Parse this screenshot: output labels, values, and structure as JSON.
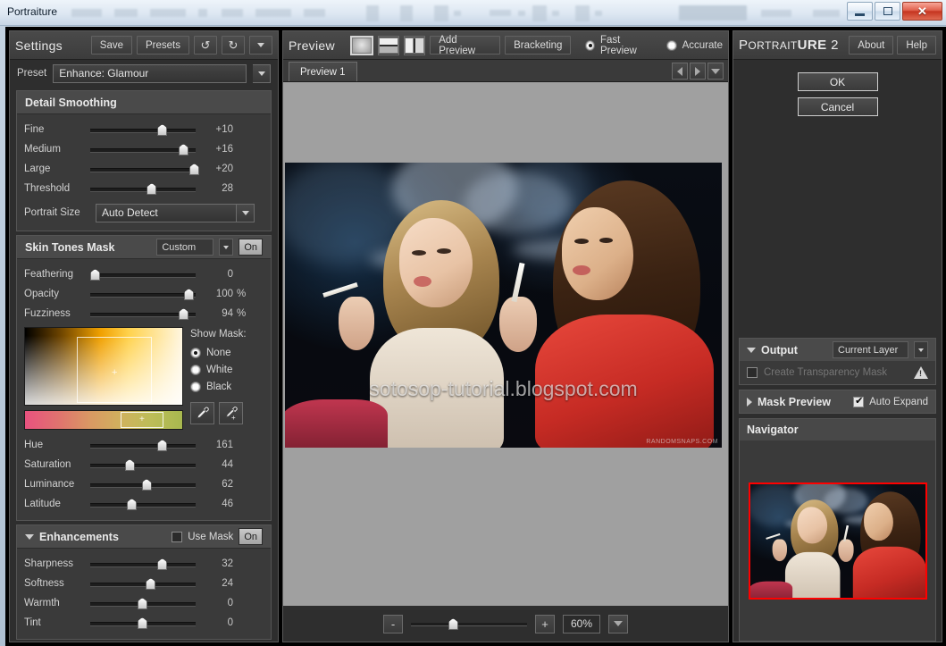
{
  "host": {
    "title": "Portraiture",
    "window_controls": {
      "minimize": "minimize-icon",
      "restore": "restore-icon",
      "close": "close-icon"
    }
  },
  "settings_panel": {
    "title": "Settings",
    "save_label": "Save",
    "presets_label": "Presets",
    "undo_icon": "undo-icon",
    "redo_icon": "redo-icon",
    "menu_icon": "chevron-down-icon",
    "preset_label": "Preset",
    "preset_value": "Enhance: Glamour",
    "detail_smoothing": {
      "title": "Detail Smoothing",
      "sliders": [
        {
          "label": "Fine",
          "value": "+10",
          "pct": 68
        },
        {
          "label": "Medium",
          "value": "+16",
          "pct": 88
        },
        {
          "label": "Large",
          "value": "+20",
          "pct": 100
        },
        {
          "label": "Threshold",
          "value": "28",
          "pct": 58
        }
      ],
      "portrait_size_label": "Portrait Size",
      "portrait_size_value": "Auto Detect"
    },
    "skin_tones_mask": {
      "title": "Skin Tones Mask",
      "mode": "Custom",
      "toggle": "On",
      "sliders": [
        {
          "label": "Feathering",
          "value": "0",
          "unit": "",
          "pct": 2
        },
        {
          "label": "Opacity",
          "value": "100",
          "unit": "%",
          "pct": 94
        },
        {
          "label": "Fuzziness",
          "value": "94",
          "unit": "%",
          "pct": 89
        }
      ],
      "show_mask_label": "Show Mask:",
      "show_mask_options": [
        "None",
        "White",
        "Black"
      ],
      "show_mask_selected": "None",
      "eyedropper_icon": "eyedropper-icon",
      "eyedropper_add_icon": "eyedropper-add-icon",
      "hsl_sliders": [
        {
          "label": "Hue",
          "value": "161",
          "pct": 68
        },
        {
          "label": "Saturation",
          "value": "44",
          "pct": 37
        },
        {
          "label": "Luminance",
          "value": "62",
          "pct": 53
        },
        {
          "label": "Latitude",
          "value": "46",
          "pct": 39
        }
      ]
    },
    "enhancements": {
      "title": "Enhancements",
      "use_mask_label": "Use Mask",
      "use_mask_checked": false,
      "toggle": "On",
      "sliders": [
        {
          "label": "Sharpness",
          "value": "32",
          "pct": 68
        },
        {
          "label": "Softness",
          "value": "24",
          "pct": 57
        },
        {
          "label": "Warmth",
          "value": "0",
          "pct": 49
        },
        {
          "label": "Tint",
          "value": "0",
          "pct": 49
        }
      ]
    }
  },
  "preview_panel": {
    "title": "Preview",
    "view_modes": [
      "single-view-icon",
      "horizontal-split-icon",
      "vertical-split-icon"
    ],
    "view_mode_active": 0,
    "add_preview_label": "Add Preview",
    "bracketing_label": "Bracketing",
    "quality_options": [
      "Fast Preview",
      "Accurate"
    ],
    "quality_selected": "Fast Preview",
    "tabs": [
      "Preview 1"
    ],
    "tab_active": "Preview 1",
    "nav_prev_icon": "arrow-left-icon",
    "nav_next_icon": "arrow-right-icon",
    "nav_menu_icon": "chevron-down-icon",
    "image": {
      "watermark": "sotosop-tutorial.blogspot.com",
      "credit": "RANDOMSNAPS.COM"
    },
    "zoom": {
      "minus_label": "-",
      "plus_label": "+",
      "level": "60%",
      "slider_pct": 36
    }
  },
  "right_panel": {
    "brand_prefix": "P",
    "brand_mid": "ORTRAIT",
    "brand_bold": "URE",
    "brand_suffix": " 2",
    "about_label": "About",
    "help_label": "Help",
    "ok_label": "OK",
    "cancel_label": "Cancel",
    "output": {
      "title": "Output",
      "target": "Current Layer",
      "transparency_mask_label": "Create Transparency Mask",
      "transparency_mask_checked": false,
      "warning_icon": "warning-icon"
    },
    "mask_preview": {
      "title": "Mask Preview",
      "auto_expand_label": "Auto Expand",
      "auto_expand_checked": true
    },
    "navigator": {
      "title": "Navigator",
      "selection_color": "#ff0000"
    }
  }
}
